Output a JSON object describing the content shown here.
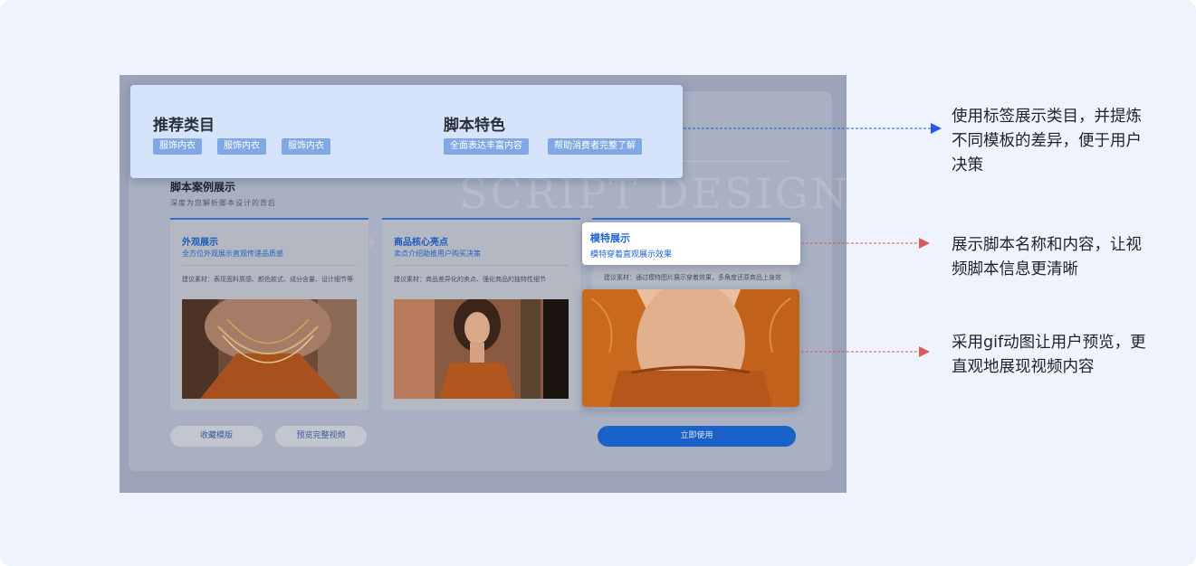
{
  "top_highlight": {
    "category_title": "推荐类目",
    "category_tags": [
      "服饰内衣",
      "服饰内衣",
      "服饰内衣"
    ],
    "feature_title": "脚本特色",
    "feature_tags": [
      "全面表达丰富内容",
      "帮助消费者完整了解"
    ]
  },
  "section": {
    "title": "脚本案例展示",
    "subtitle": "深度为您解析脚本设计的背后",
    "watermark": "SCRIPT DESIGN"
  },
  "cards": [
    {
      "title": "外观展示",
      "subtitle": "全方位外观展示直观传递品质感",
      "note": "建议素材：表现面料质感、颜色款式、成分含量、设计细节等"
    },
    {
      "title": "商品核心亮点",
      "subtitle": "卖点介绍助推用户购买决策",
      "note": "建议素材：商品差异化的卖点、强化商品的独特性细节"
    },
    {
      "title": "模特展示",
      "subtitle": "模特穿着直观展示效果",
      "note": "建议素材：通过模特图片展示穿着效果，多角度还原商品上身效果"
    }
  ],
  "buttons": {
    "collect": "收藏模版",
    "preview": "预览完整视频",
    "use": "立即使用"
  },
  "annotations": [
    "使用标签展示类目，并提炼不同模板的差异，便于用户决策",
    "展示脚本名称和内容，让视频脚本信息更清晰",
    "采用gif动图让用户预览，更直观地展现视频内容"
  ],
  "colors": {
    "page_bg": "#eef3fd",
    "accent_blue": "#1d63d6",
    "arrow_blue": "#2357e8",
    "arrow_red": "#d85a5a"
  }
}
